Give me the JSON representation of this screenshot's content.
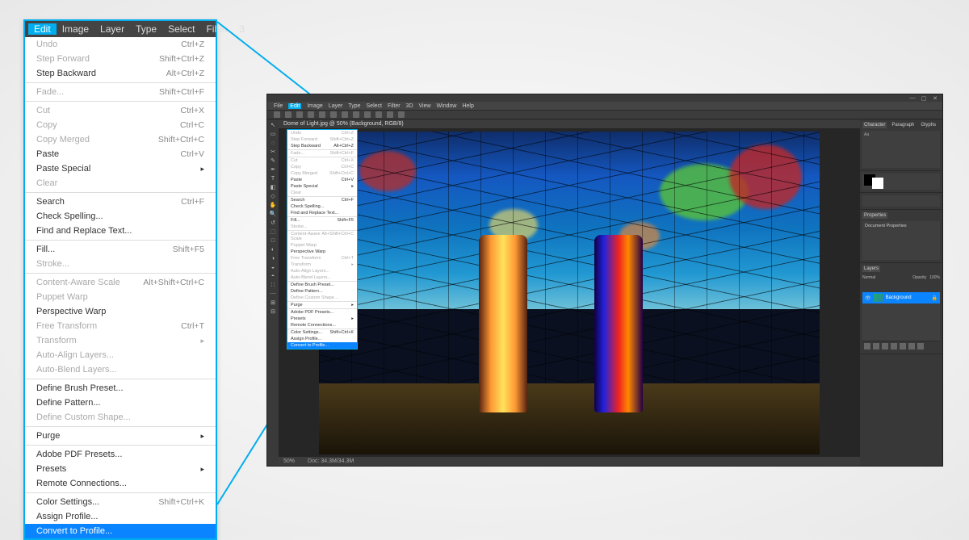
{
  "zoom_menubar": {
    "items": [
      "Edit",
      "Image",
      "Layer",
      "Type",
      "Select",
      "Filter",
      "3"
    ],
    "active": "Edit"
  },
  "edit_menu": {
    "groups": [
      [
        {
          "label": "Undo",
          "shortcut": "Ctrl+Z",
          "enabled": false
        },
        {
          "label": "Step Forward",
          "shortcut": "Shift+Ctrl+Z",
          "enabled": false
        },
        {
          "label": "Step Backward",
          "shortcut": "Alt+Ctrl+Z",
          "enabled": true
        }
      ],
      [
        {
          "label": "Fade...",
          "shortcut": "Shift+Ctrl+F",
          "enabled": false
        }
      ],
      [
        {
          "label": "Cut",
          "shortcut": "Ctrl+X",
          "enabled": false
        },
        {
          "label": "Copy",
          "shortcut": "Ctrl+C",
          "enabled": false
        },
        {
          "label": "Copy Merged",
          "shortcut": "Shift+Ctrl+C",
          "enabled": false
        },
        {
          "label": "Paste",
          "shortcut": "Ctrl+V",
          "enabled": true
        },
        {
          "label": "Paste Special",
          "submenu": true,
          "enabled": true
        },
        {
          "label": "Clear",
          "enabled": false
        }
      ],
      [
        {
          "label": "Search",
          "shortcut": "Ctrl+F",
          "enabled": true
        },
        {
          "label": "Check Spelling...",
          "enabled": true
        },
        {
          "label": "Find and Replace Text...",
          "enabled": true
        }
      ],
      [
        {
          "label": "Fill...",
          "shortcut": "Shift+F5",
          "enabled": true
        },
        {
          "label": "Stroke...",
          "enabled": false
        }
      ],
      [
        {
          "label": "Content-Aware Scale",
          "shortcut": "Alt+Shift+Ctrl+C",
          "enabled": false
        },
        {
          "label": "Puppet Warp",
          "enabled": false
        },
        {
          "label": "Perspective Warp",
          "enabled": true
        },
        {
          "label": "Free Transform",
          "shortcut": "Ctrl+T",
          "enabled": false
        },
        {
          "label": "Transform",
          "submenu": true,
          "enabled": false
        },
        {
          "label": "Auto-Align Layers...",
          "enabled": false
        },
        {
          "label": "Auto-Blend Layers...",
          "enabled": false
        }
      ],
      [
        {
          "label": "Define Brush Preset...",
          "enabled": true
        },
        {
          "label": "Define Pattern...",
          "enabled": true
        },
        {
          "label": "Define Custom Shape...",
          "enabled": false
        }
      ],
      [
        {
          "label": "Purge",
          "submenu": true,
          "enabled": true
        }
      ],
      [
        {
          "label": "Adobe PDF Presets...",
          "enabled": true
        },
        {
          "label": "Presets",
          "submenu": true,
          "enabled": true
        },
        {
          "label": "Remote Connections...",
          "enabled": true
        }
      ],
      [
        {
          "label": "Color Settings...",
          "shortcut": "Shift+Ctrl+K",
          "enabled": true
        },
        {
          "label": "Assign Profile...",
          "enabled": true
        },
        {
          "label": "Convert to Profile...",
          "enabled": true,
          "highlight": true
        }
      ]
    ]
  },
  "ps": {
    "menubar": [
      "File",
      "Edit",
      "Image",
      "Layer",
      "Type",
      "Select",
      "Filter",
      "3D",
      "View",
      "Window",
      "Help"
    ],
    "menubar_active": "Edit",
    "doc_tab": "Dome of Light.jpg @ 50% (Background, RGB/8)",
    "status_zoom": "50%",
    "status_info": "Doc: 34.3M/34.3M",
    "panels": {
      "color_tabs": [
        "Character",
        "Paragraph",
        "Glyphs"
      ],
      "swatch_fg": "#000000",
      "swatch_bg": "#ffffff",
      "properties_tab": "Properties",
      "properties_title": "Document Properties",
      "layers_tabs": [
        "Layers"
      ],
      "layer_name": "Background",
      "blend": "Normal",
      "opacity": "Opacity",
      "opacity_value": "100%"
    },
    "tools": [
      "↖",
      "▭",
      "◌",
      "✂",
      "✎",
      "✒",
      "T",
      "◧",
      "◇",
      "✋",
      "🔍",
      "↺",
      "⬚",
      "□",
      "◐",
      "◑",
      "◒",
      "◓",
      "∷",
      "⋯",
      "⊞",
      "⊟"
    ]
  },
  "ps_dropdown": {
    "highlight_label": "Convert to Profile..."
  }
}
